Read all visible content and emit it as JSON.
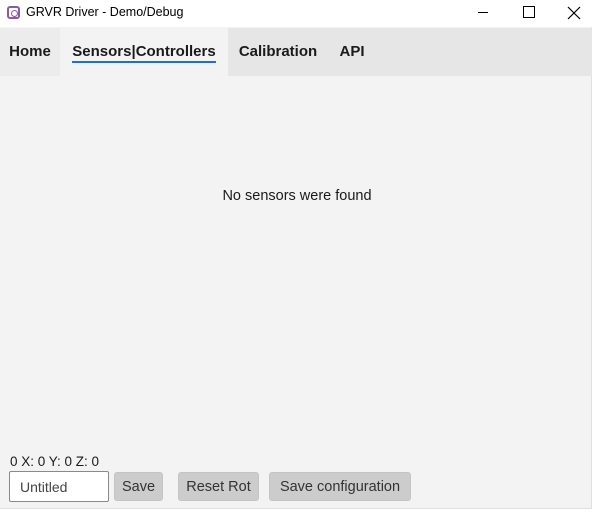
{
  "window": {
    "title": "GRVR Driver - Demo/Debug",
    "icon": "app-logo-icon",
    "controls": [
      "minimize-icon",
      "maximize-icon",
      "close-icon"
    ]
  },
  "tabs": [
    {
      "label": "Home",
      "active": false
    },
    {
      "label": "Sensors|Controllers",
      "active": true
    },
    {
      "label": "Calibration",
      "active": false
    },
    {
      "label": "API",
      "active": false
    }
  ],
  "main": {
    "empty_message": "No sensors were found"
  },
  "footer": {
    "readout": "0 X: 0 Y: 0 Z: 0",
    "name_input": {
      "value": "Untitled"
    },
    "save_label": "Save",
    "reset_rot_label": "Reset Rot",
    "save_configuration_label": "Save configuration"
  },
  "colors": {
    "accent_underline": "#1e6fd0",
    "app_icon": "#8a5aa8",
    "button_bg": "#cccccc",
    "content_bg": "#f3f3f3",
    "tabstrip_bg": "#e6e6e6"
  }
}
